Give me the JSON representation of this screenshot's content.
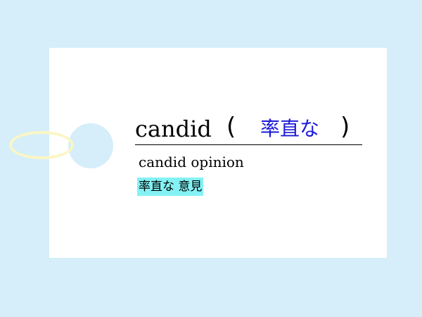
{
  "card": {
    "word": "candid",
    "paren_open": "(",
    "paren_close": ")",
    "meaning": "率直な",
    "phrase": "candid opinion",
    "phrase_translation": "率直な 意見"
  },
  "colors": {
    "background": "#d5eef9",
    "card": "#ffffff",
    "meaning_text": "#1a1ad8",
    "highlight": "#84f2f5",
    "ring": "#fbf6c4"
  }
}
